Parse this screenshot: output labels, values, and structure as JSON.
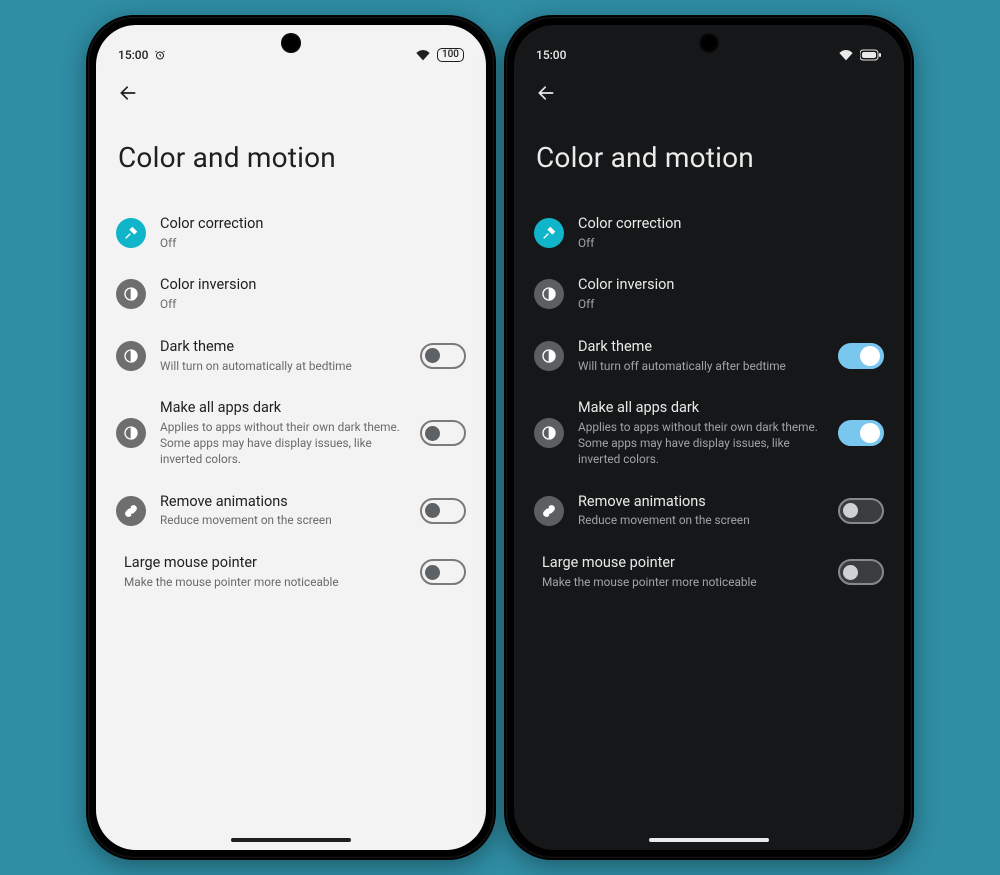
{
  "colors": {
    "accent_teal": "#10b5c9",
    "toggle_on": "#79c7ef"
  },
  "status": {
    "time": "15:00",
    "battery_label": "100"
  },
  "page_title": "Color and motion",
  "phones": {
    "a": {
      "mode": "light"
    },
    "b": {
      "mode": "dark"
    }
  },
  "items": [
    {
      "key": "color_correction",
      "icon": "eyedropper-icon",
      "icon_color": "teal",
      "title": "Color correction",
      "sub": "Off",
      "has_toggle": false
    },
    {
      "key": "color_inversion",
      "icon": "contrast-icon",
      "icon_color": "grey",
      "title": "Color inversion",
      "sub": "Off",
      "has_toggle": false
    },
    {
      "key": "dark_theme",
      "icon": "contrast-icon",
      "icon_color": "grey",
      "title": "Dark theme",
      "sub_light": "Will turn on automatically at bedtime",
      "sub_dark": "Will turn off automatically after bedtime",
      "has_toggle": true,
      "toggle_light": "off",
      "toggle_dark": "on"
    },
    {
      "key": "make_all_apps_dark",
      "icon": "contrast-icon",
      "icon_color": "grey",
      "title": "Make all apps dark",
      "sub": "Applies to apps without their own dark theme. Some apps may have display issues, like inverted colors.",
      "has_toggle": true,
      "toggle_light": "off",
      "toggle_dark": "on"
    },
    {
      "key": "remove_animations",
      "icon": "link-icon",
      "icon_color": "grey",
      "title": "Remove animations",
      "sub": "Reduce movement on the screen",
      "has_toggle": true,
      "toggle_light": "off",
      "toggle_dark": "off"
    },
    {
      "key": "large_mouse_pointer",
      "icon": null,
      "title": "Large mouse pointer",
      "sub": "Make the mouse pointer more noticeable",
      "has_toggle": true,
      "toggle_light": "off",
      "toggle_dark": "off"
    }
  ]
}
